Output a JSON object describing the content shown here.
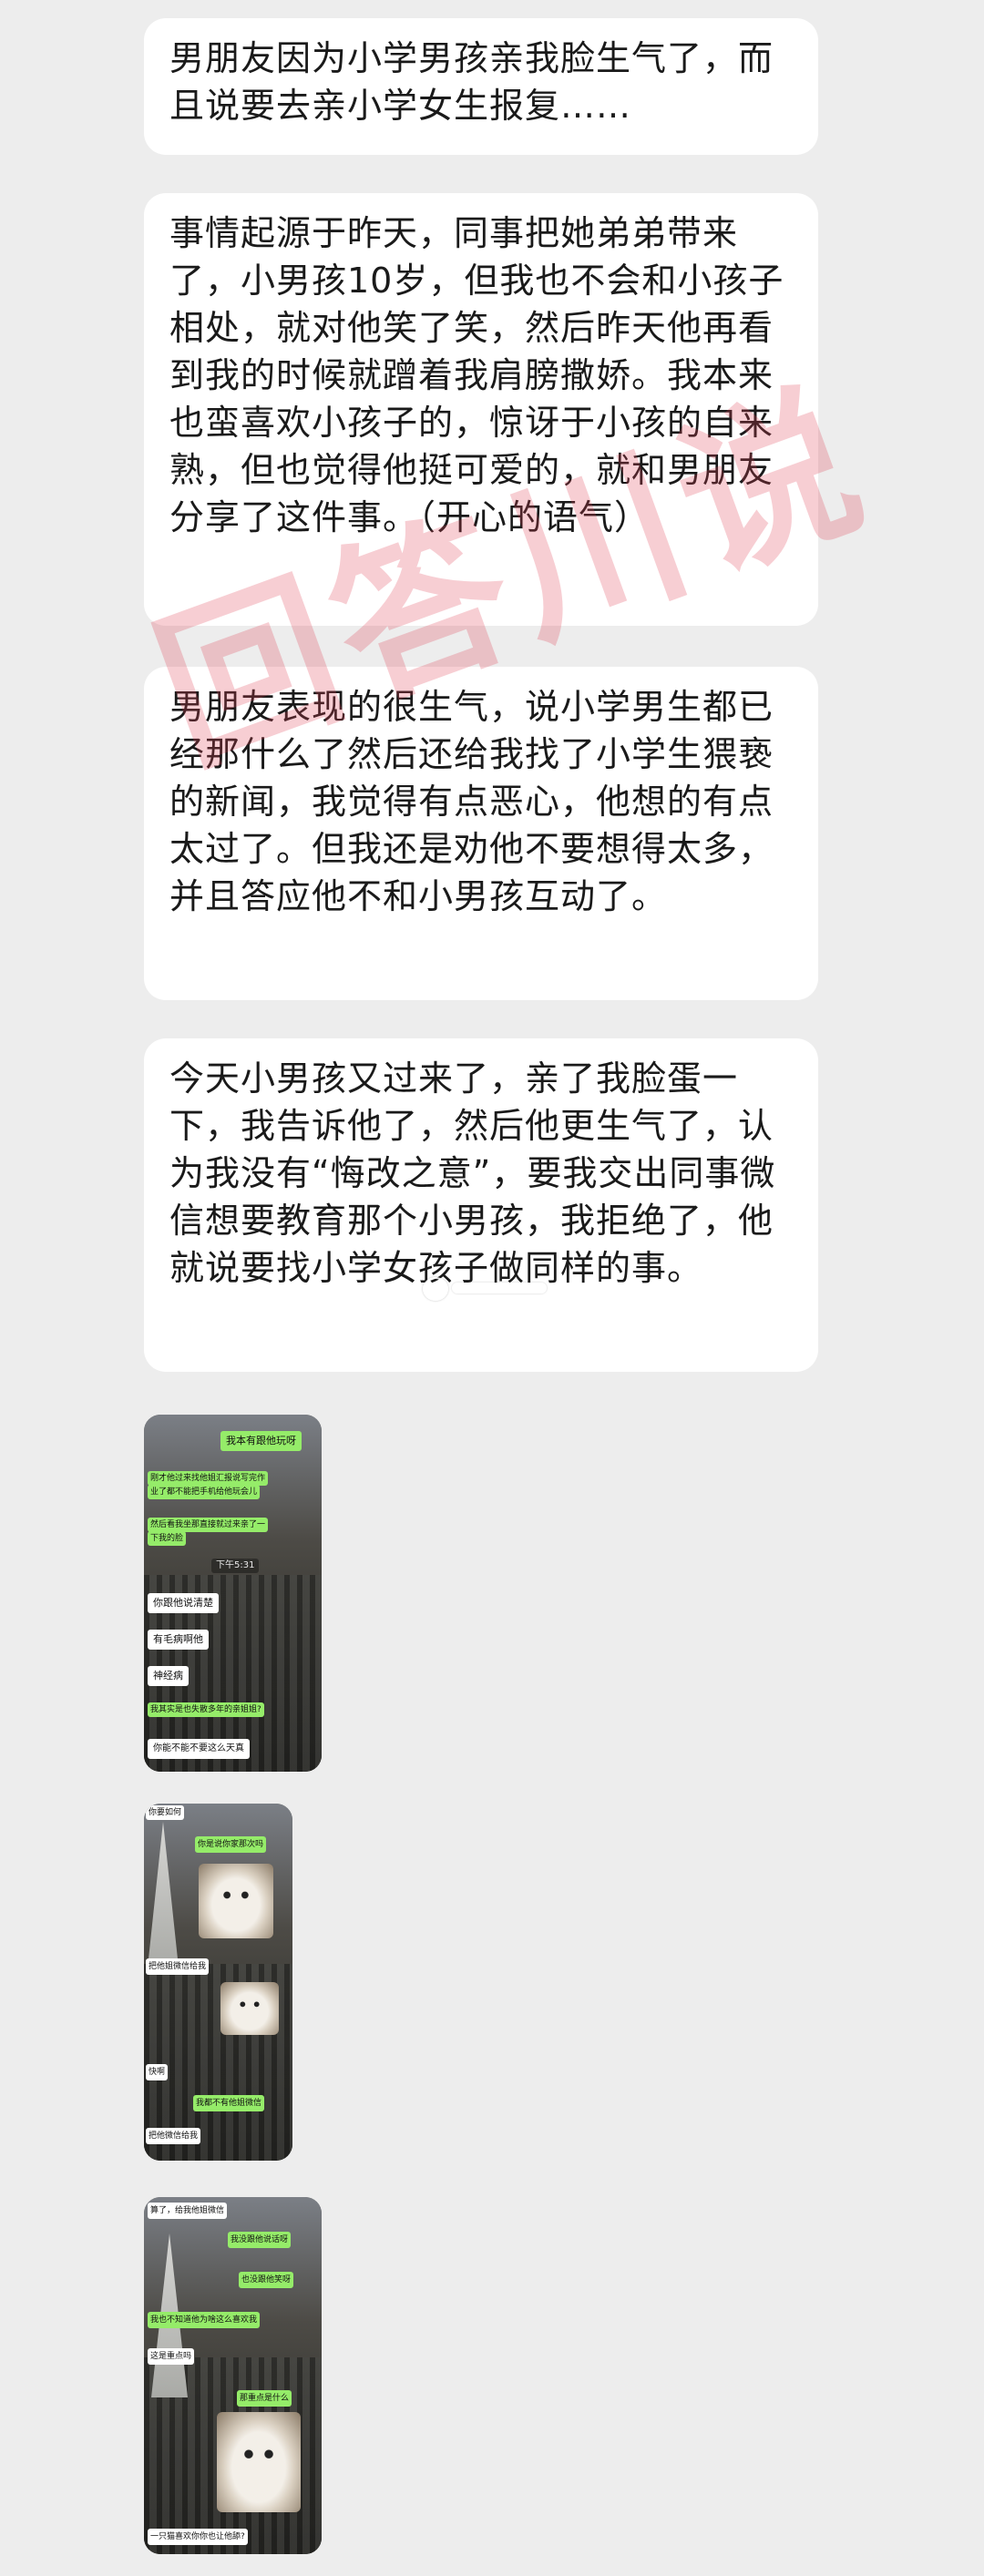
{
  "messages": [
    "男朋友因为小学男孩亲我脸生气了，而且说要去亲小学女生报复……",
    "事情起源于昨天，同事把她弟弟带来了，小男孩10岁，但我也不会和小孩子相处，就对他笑了笑，然后昨天他再看到我的时候就蹭着我肩膀撒娇。我本来也蛮喜欢小孩子的，惊讶于小孩的自来熟，但也觉得他挺可爱的，就和男朋友分享了这件事。（开心的语气）",
    "男朋友表现的很生气，说小学男生都已经那什么了然后还给我找了小学生猥亵的新闻，我觉得有点恶心，他想的有点太过了。但我还是劝他不要想得太多，并且答应他不和小男孩互动了。",
    "今天小男孩又过来了，亲了我脸蛋一下，我告诉他了，然后他更生气了，认为我没有“悔改之意”，要我交出同事微信想要教育那个小男孩，我拒绝了，他就说要找小学女孩子做同样的事。"
  ],
  "watermark": "回答川说",
  "screenshots": {
    "shot1": {
      "chats": [
        {
          "side": "g",
          "text": "我本有跟他玩呀"
        },
        {
          "side": "g",
          "text": "刚才他过来找他姐汇报说写完作"
        },
        {
          "side": "g",
          "text": "业了都不能把手机给他玩会儿"
        },
        {
          "side": "g",
          "text": "然后看我坐那直接就过来亲了一"
        },
        {
          "side": "g",
          "text": "下我的脸"
        },
        {
          "side": "t",
          "text": "下午5:31"
        },
        {
          "side": "w",
          "text": "你跟他说清楚"
        },
        {
          "side": "w",
          "text": "有毛病啊他"
        },
        {
          "side": "w",
          "text": "神经病"
        },
        {
          "side": "g",
          "text": "我其实是也失散多年的亲姐姐?"
        },
        {
          "side": "w",
          "text": "你能不能不要这么天真"
        }
      ]
    },
    "shot2": {
      "chats": [
        {
          "side": "w",
          "text": "你要如何"
        },
        {
          "side": "g",
          "text": "你是说你家那次吗"
        },
        {
          "side": "w",
          "text": "把他姐微信给我"
        },
        {
          "side": "w",
          "text": "快啊"
        },
        {
          "side": "g",
          "text": "我都不有他姐微信"
        },
        {
          "side": "w",
          "text": "把他微信给我"
        }
      ]
    },
    "shot3": {
      "chats": [
        {
          "side": "w",
          "text": "算了，给我他姐微信"
        },
        {
          "side": "g",
          "text": "我没跟他说话呀"
        },
        {
          "side": "g",
          "text": "也没跟他笑呀"
        },
        {
          "side": "g",
          "text": "我也不知道他为啥这么喜欢我"
        },
        {
          "side": "w",
          "text": "这是重点吗"
        },
        {
          "side": "g",
          "text": "那重点是什么"
        },
        {
          "side": "w",
          "text": "一只猫喜欢你你也让他舔?"
        }
      ]
    }
  }
}
